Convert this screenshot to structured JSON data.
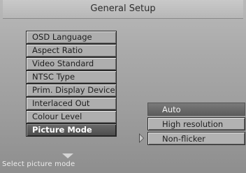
{
  "header": {
    "title": "General Setup"
  },
  "menu": {
    "items": [
      {
        "label": "OSD Language"
      },
      {
        "label": "Aspect Ratio"
      },
      {
        "label": "Video Standard"
      },
      {
        "label": "NTSC Type"
      },
      {
        "label": "Prim. Display Device"
      },
      {
        "label": "Interlaced Out"
      },
      {
        "label": "Colour Level"
      },
      {
        "label": "Picture Mode"
      }
    ],
    "selected": "Picture Mode",
    "more_below_icon": "chevron-down-icon"
  },
  "submenu": {
    "options": [
      {
        "label": "Auto"
      },
      {
        "label": "High resolution"
      },
      {
        "label": "Non-flicker"
      }
    ],
    "highlighted": "Auto",
    "pointer_icon": "chevron-right-icon"
  },
  "status": {
    "hint": "Select picture mode"
  }
}
